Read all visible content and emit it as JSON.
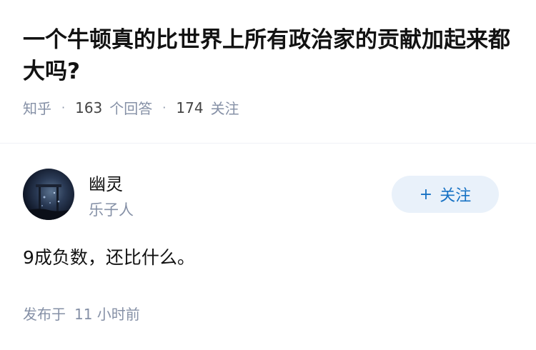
{
  "question": {
    "title": "一个牛顿真的比世界上所有政治家的贡献加起来都大吗?",
    "source": "知乎",
    "answer_count": "163",
    "answer_label": "个回答",
    "follower_count": "174",
    "follower_label": "关注"
  },
  "author": {
    "name": "幽灵",
    "headline": "乐子人",
    "avatar_icon": "avatar-image",
    "follow_plus": "+",
    "follow_label": "关注"
  },
  "answer": {
    "text": "9成负数，还比什么。",
    "publish_label": "发布于",
    "publish_time": "11 小时前"
  },
  "colors": {
    "title": "#121212",
    "meta": "#8590a6",
    "follow_bg": "#e9f1fa",
    "follow_text": "#1772c4"
  }
}
